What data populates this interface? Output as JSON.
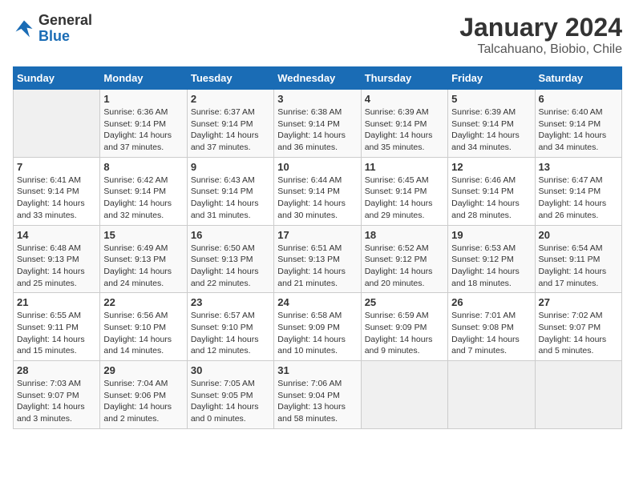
{
  "logo": {
    "general": "General",
    "blue": "Blue"
  },
  "header": {
    "month_year": "January 2024",
    "location": "Talcahuano, Biobio, Chile"
  },
  "weekdays": [
    "Sunday",
    "Monday",
    "Tuesday",
    "Wednesday",
    "Thursday",
    "Friday",
    "Saturday"
  ],
  "weeks": [
    [
      {
        "day": "",
        "empty": true
      },
      {
        "day": "1",
        "sunrise": "6:36 AM",
        "sunset": "9:14 PM",
        "daylight": "14 hours and 37 minutes."
      },
      {
        "day": "2",
        "sunrise": "6:37 AM",
        "sunset": "9:14 PM",
        "daylight": "14 hours and 37 minutes."
      },
      {
        "day": "3",
        "sunrise": "6:38 AM",
        "sunset": "9:14 PM",
        "daylight": "14 hours and 36 minutes."
      },
      {
        "day": "4",
        "sunrise": "6:39 AM",
        "sunset": "9:14 PM",
        "daylight": "14 hours and 35 minutes."
      },
      {
        "day": "5",
        "sunrise": "6:39 AM",
        "sunset": "9:14 PM",
        "daylight": "14 hours and 34 minutes."
      },
      {
        "day": "6",
        "sunrise": "6:40 AM",
        "sunset": "9:14 PM",
        "daylight": "14 hours and 34 minutes."
      }
    ],
    [
      {
        "day": "7",
        "sunrise": "6:41 AM",
        "sunset": "9:14 PM",
        "daylight": "14 hours and 33 minutes."
      },
      {
        "day": "8",
        "sunrise": "6:42 AM",
        "sunset": "9:14 PM",
        "daylight": "14 hours and 32 minutes."
      },
      {
        "day": "9",
        "sunrise": "6:43 AM",
        "sunset": "9:14 PM",
        "daylight": "14 hours and 31 minutes."
      },
      {
        "day": "10",
        "sunrise": "6:44 AM",
        "sunset": "9:14 PM",
        "daylight": "14 hours and 30 minutes."
      },
      {
        "day": "11",
        "sunrise": "6:45 AM",
        "sunset": "9:14 PM",
        "daylight": "14 hours and 29 minutes."
      },
      {
        "day": "12",
        "sunrise": "6:46 AM",
        "sunset": "9:14 PM",
        "daylight": "14 hours and 28 minutes."
      },
      {
        "day": "13",
        "sunrise": "6:47 AM",
        "sunset": "9:14 PM",
        "daylight": "14 hours and 26 minutes."
      }
    ],
    [
      {
        "day": "14",
        "sunrise": "6:48 AM",
        "sunset": "9:13 PM",
        "daylight": "14 hours and 25 minutes."
      },
      {
        "day": "15",
        "sunrise": "6:49 AM",
        "sunset": "9:13 PM",
        "daylight": "14 hours and 24 minutes."
      },
      {
        "day": "16",
        "sunrise": "6:50 AM",
        "sunset": "9:13 PM",
        "daylight": "14 hours and 22 minutes."
      },
      {
        "day": "17",
        "sunrise": "6:51 AM",
        "sunset": "9:13 PM",
        "daylight": "14 hours and 21 minutes."
      },
      {
        "day": "18",
        "sunrise": "6:52 AM",
        "sunset": "9:12 PM",
        "daylight": "14 hours and 20 minutes."
      },
      {
        "day": "19",
        "sunrise": "6:53 AM",
        "sunset": "9:12 PM",
        "daylight": "14 hours and 18 minutes."
      },
      {
        "day": "20",
        "sunrise": "6:54 AM",
        "sunset": "9:11 PM",
        "daylight": "14 hours and 17 minutes."
      }
    ],
    [
      {
        "day": "21",
        "sunrise": "6:55 AM",
        "sunset": "9:11 PM",
        "daylight": "14 hours and 15 minutes."
      },
      {
        "day": "22",
        "sunrise": "6:56 AM",
        "sunset": "9:10 PM",
        "daylight": "14 hours and 14 minutes."
      },
      {
        "day": "23",
        "sunrise": "6:57 AM",
        "sunset": "9:10 PM",
        "daylight": "14 hours and 12 minutes."
      },
      {
        "day": "24",
        "sunrise": "6:58 AM",
        "sunset": "9:09 PM",
        "daylight": "14 hours and 10 minutes."
      },
      {
        "day": "25",
        "sunrise": "6:59 AM",
        "sunset": "9:09 PM",
        "daylight": "14 hours and 9 minutes."
      },
      {
        "day": "26",
        "sunrise": "7:01 AM",
        "sunset": "9:08 PM",
        "daylight": "14 hours and 7 minutes."
      },
      {
        "day": "27",
        "sunrise": "7:02 AM",
        "sunset": "9:07 PM",
        "daylight": "14 hours and 5 minutes."
      }
    ],
    [
      {
        "day": "28",
        "sunrise": "7:03 AM",
        "sunset": "9:07 PM",
        "daylight": "14 hours and 3 minutes."
      },
      {
        "day": "29",
        "sunrise": "7:04 AM",
        "sunset": "9:06 PM",
        "daylight": "14 hours and 2 minutes."
      },
      {
        "day": "30",
        "sunrise": "7:05 AM",
        "sunset": "9:05 PM",
        "daylight": "14 hours and 0 minutes."
      },
      {
        "day": "31",
        "sunrise": "7:06 AM",
        "sunset": "9:04 PM",
        "daylight": "13 hours and 58 minutes."
      },
      {
        "day": "",
        "empty": true
      },
      {
        "day": "",
        "empty": true
      },
      {
        "day": "",
        "empty": true
      }
    ]
  ],
  "labels": {
    "sunrise": "Sunrise:",
    "sunset": "Sunset:",
    "daylight": "Daylight:"
  }
}
